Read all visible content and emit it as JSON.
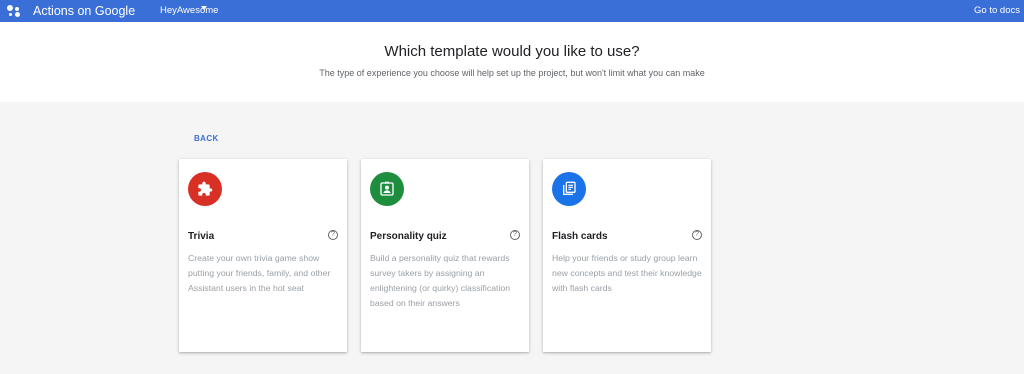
{
  "topbar": {
    "brand": "Actions on Google",
    "project": "HeyAwesome",
    "docs_link": "Go to docs",
    "color": "#3b6fd8"
  },
  "header": {
    "title": "Which template would you like to use?",
    "subtitle": "The type of experience you choose will help set up the project, but won't limit what you can make"
  },
  "back_label": "BACK",
  "cards": [
    {
      "title": "Trivia",
      "icon": "puzzle-icon",
      "color": "#d93025",
      "description": "Create your own trivia game show putting your friends, family, and other Assistant users in the hot seat"
    },
    {
      "title": "Personality quiz",
      "icon": "portrait-icon",
      "color": "#1e8e3e",
      "description": "Build a personality quiz that rewards survey takers by assigning an enlightening (or quirky) classification based on their answers"
    },
    {
      "title": "Flash cards",
      "icon": "flash-cards-icon",
      "color": "#1a73e8",
      "description": "Help your friends or study group learn new concepts and test their knowledge with flash cards"
    }
  ],
  "help_glyph": "?"
}
